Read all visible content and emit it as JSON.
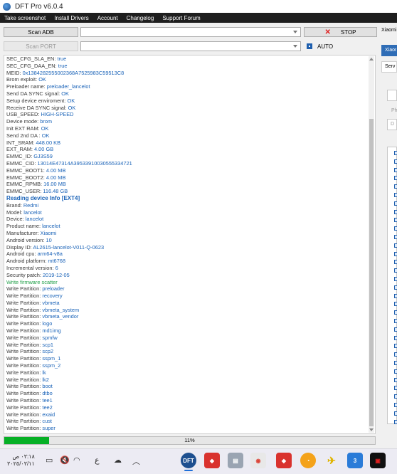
{
  "window": {
    "title": "DFT Pro v6.0.4"
  },
  "menu": [
    "Take screenshot",
    "Install Drivers",
    "Account",
    "Changelog",
    "Support Forum"
  ],
  "toolbar": {
    "scan_adb": "Scan ADB",
    "scan_port": "Scan PORT",
    "stop": "STOP",
    "auto": "AUTO"
  },
  "right_panel": {
    "tab_top": "Xiaomi",
    "tab2": "Xiaomi",
    "tab3": "Serv",
    "label_ph": "Ph",
    "label_d": "D"
  },
  "log": [
    {
      "label": "SEC_CFG_SLA_EN: ",
      "value": "true"
    },
    {
      "label": "SEC_CFG_DAA_EN: ",
      "value": "true"
    },
    {
      "label": "MEID: ",
      "value": "0x1384282555002368A7525983C59513C8"
    },
    {
      "label": "Brom exploit: ",
      "value": "OK"
    },
    {
      "label": "Preloader name: ",
      "value": "preloader_lancelot"
    },
    {
      "label": "Send DA SYNC signal: ",
      "value": "OK"
    },
    {
      "label": "Setup device enviroment: ",
      "value": "OK"
    },
    {
      "label": "Receive DA SYNC signal: ",
      "value": "OK"
    },
    {
      "label": "USB_SPEED: ",
      "value": "HIGH-SPEED"
    },
    {
      "label": "Device mode: ",
      "value": "brom"
    },
    {
      "label": "Init EXT RAM: ",
      "value": "OK"
    },
    {
      "label": "Send 2nd DA : ",
      "value": "OK"
    },
    {
      "label": "INT_SRAM: ",
      "value": "448.00 KB"
    },
    {
      "label": "EXT_RAM: ",
      "value": "4.00 GB"
    },
    {
      "label": "EMMC_ID: ",
      "value": "GJ3S59"
    },
    {
      "label": "EMMC_CID: ",
      "value": "13014E47314A39533910030555334721"
    },
    {
      "label": "EMMC_BOOT1: ",
      "value": "4.00 MB"
    },
    {
      "label": "EMMC_BOOT2: ",
      "value": "4.00 MB"
    },
    {
      "label": "EMMC_RPMB: ",
      "value": "16.00 MB"
    },
    {
      "label": "EMMC_USER: ",
      "value": "116.48 GB"
    },
    {
      "header": "Reading device Info [EXT4]"
    },
    {
      "label": "Brand: ",
      "value": "Redmi"
    },
    {
      "label": "Model: ",
      "value": "lancelot"
    },
    {
      "label": "Device: ",
      "value": "lancelot"
    },
    {
      "label": "Product name: ",
      "value": "lancelot"
    },
    {
      "label": "Manufacturer: ",
      "value": "Xiaomi"
    },
    {
      "label": "Android version: ",
      "value": "10"
    },
    {
      "label": "Display ID: ",
      "value": "AL2615-lancelot-V011-Q-0623"
    },
    {
      "label": "Android cpu: ",
      "value": "arm64-v8a"
    },
    {
      "label": "Android platform: ",
      "value": "mt6768"
    },
    {
      "label": "Incremental version: ",
      "value": "6"
    },
    {
      "label": "Security patch: ",
      "value": "2019-12-05"
    },
    {
      "green": "Write firmware scatter"
    },
    {
      "label": "Write Partition: ",
      "value": "preloader"
    },
    {
      "label": "Write Partition: ",
      "value": "recovery"
    },
    {
      "label": "Write Partition: ",
      "value": "vbmeta"
    },
    {
      "label": "Write Partition: ",
      "value": "vbmeta_system"
    },
    {
      "label": "Write Partition: ",
      "value": "vbmeta_vendor"
    },
    {
      "label": "Write Partition: ",
      "value": "logo"
    },
    {
      "label": "Write Partition: ",
      "value": "md1img"
    },
    {
      "label": "Write Partition: ",
      "value": "spmfw"
    },
    {
      "label": "Write Partition: ",
      "value": "scp1"
    },
    {
      "label": "Write Partition: ",
      "value": "scp2"
    },
    {
      "label": "Write Partition: ",
      "value": "sspm_1"
    },
    {
      "label": "Write Partition: ",
      "value": "sspm_2"
    },
    {
      "label": "Write Partition: ",
      "value": "lk"
    },
    {
      "label": "Write Partition: ",
      "value": "lk2"
    },
    {
      "label": "Write Partition: ",
      "value": "boot"
    },
    {
      "label": "Write Partition: ",
      "value": "dtbo"
    },
    {
      "label": "Write Partition: ",
      "value": "tee1"
    },
    {
      "label": "Write Partition: ",
      "value": "tee2"
    },
    {
      "label": "Write Partition: ",
      "value": "exaid"
    },
    {
      "label": "Write Partition: ",
      "value": "cust"
    },
    {
      "label": "Write Partition: ",
      "value": "super"
    }
  ],
  "progress": {
    "percent": 12,
    "text": "11%"
  },
  "taskbar": {
    "time": "٠٢:١٨ ص",
    "date": "٢٠٢٥/٠٢/١١",
    "lang": "ع"
  },
  "colors": {
    "progress": "#06b025",
    "value_text": "#1a63b8",
    "green_text": "#23a04a",
    "menubar": "#1e1e1e"
  }
}
